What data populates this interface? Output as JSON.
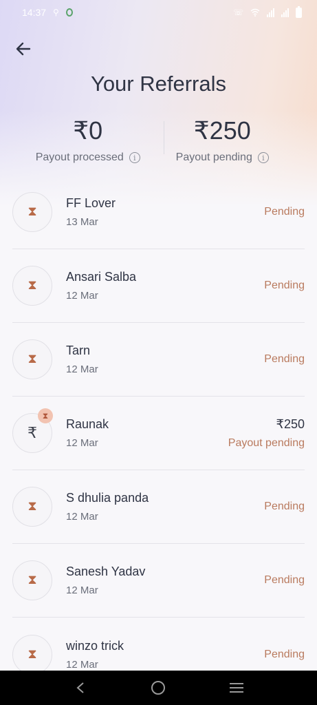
{
  "status_bar": {
    "time": "14:37"
  },
  "header": {
    "title": "Your Referrals"
  },
  "summary": {
    "processed_amount": "₹0",
    "processed_label": "Payout processed",
    "pending_amount": "₹250",
    "pending_label": "Payout pending"
  },
  "referrals": [
    {
      "name": "FF Lover",
      "date": "13 Mar",
      "status": "Pending",
      "amount": ""
    },
    {
      "name": "Ansari Salba",
      "date": "12 Mar",
      "status": "Pending",
      "amount": ""
    },
    {
      "name": "Tarn",
      "date": "12 Mar",
      "status": "Pending",
      "amount": ""
    },
    {
      "name": "Raunak",
      "date": "12 Mar",
      "status": "Payout pending",
      "amount": "₹250"
    },
    {
      "name": "S dhulia panda",
      "date": "12 Mar",
      "status": "Pending",
      "amount": ""
    },
    {
      "name": "Sanesh Yadav",
      "date": "12 Mar",
      "status": "Pending",
      "amount": ""
    },
    {
      "name": "winzo trick",
      "date": "12 Mar",
      "status": "Pending",
      "amount": ""
    }
  ],
  "icons": {
    "pending": "hourglass-icon",
    "payout": "rupee-icon",
    "info": "info-icon",
    "back": "arrow-left-icon"
  },
  "colors": {
    "status_accent": "#b97a5e",
    "badge_bg": "#f2c3b1"
  }
}
